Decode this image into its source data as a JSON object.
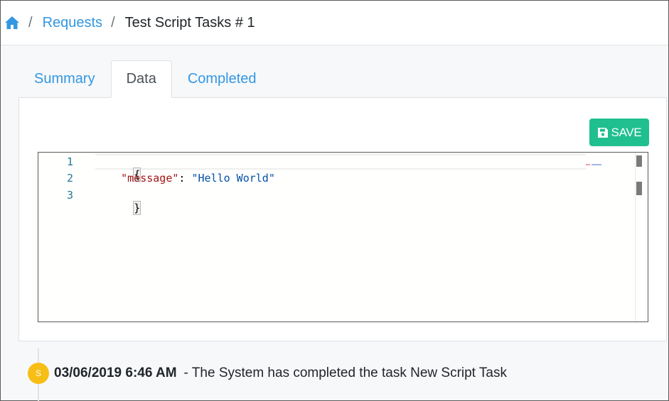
{
  "breadcrumb": {
    "home_icon": "home-icon",
    "separator": "/",
    "link": "Requests",
    "current": "Test Script Tasks # 1"
  },
  "tabs": [
    {
      "label": "Summary",
      "active": false
    },
    {
      "label": "Data",
      "active": true
    },
    {
      "label": "Completed",
      "active": false
    }
  ],
  "toolbar": {
    "save_icon": "floppy-disk-icon",
    "save_label": "SAVE"
  },
  "editor": {
    "line_numbers": [
      "1",
      "2",
      "3"
    ],
    "lines": {
      "open": "{",
      "key": "\"message\"",
      "colon": ": ",
      "value": "\"Hello World\"",
      "close": "}"
    }
  },
  "timeline": {
    "avatar_initial": "S",
    "timestamp": "03/06/2019 6:46 AM",
    "text": "- The System has completed the task New Script Task"
  },
  "colors": {
    "link": "#3397e1",
    "save_button": "#1fbf8f",
    "avatar": "#f7be15",
    "json_key": "#a31515",
    "json_string": "#0451a5",
    "line_number": "#237893"
  }
}
